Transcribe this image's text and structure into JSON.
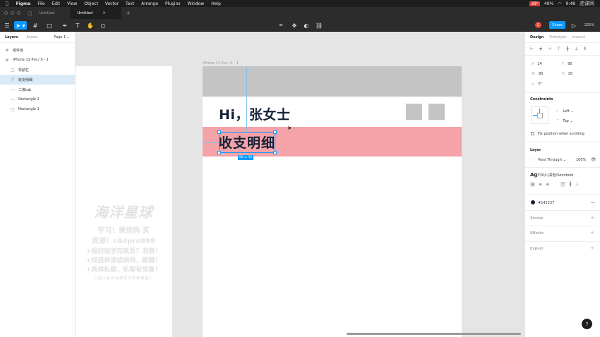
{
  "menubar": {
    "app": "Figma",
    "items": [
      "File",
      "Edit",
      "View",
      "Object",
      "Vector",
      "Text",
      "Arrange",
      "Plugins",
      "Window",
      "Help"
    ],
    "battery": "39°",
    "percent": "49%",
    "time": "9:48",
    "watermark": "虎课网"
  },
  "tabs": [
    {
      "label": "Untitled"
    },
    {
      "label": "Untitled"
    }
  ],
  "toolbar": {
    "share_label": "Share",
    "avatar_letter": "G",
    "zoom": "221%"
  },
  "left_panel": {
    "tab_layers": "Layers",
    "tab_assets": "Assets",
    "page": "Page 1",
    "layers": [
      {
        "label": "组件库",
        "icon": "#"
      },
      {
        "label": "iPhone 11 Pro / X - 1",
        "icon": "#"
      },
      {
        "label": "导航栏",
        "icon": "□"
      },
      {
        "label": "收支明细",
        "icon": "T"
      },
      {
        "label": "二级tab",
        "icon": "—"
      },
      {
        "label": "Rectangle 2",
        "icon": "—"
      },
      {
        "label": "Rectangle 1",
        "icon": "□"
      }
    ]
  },
  "canvas": {
    "frame_label": "iPhone 11 Pro / X - 1",
    "greeting": "Hi，张女士",
    "section_title": "收支明细",
    "size_badge": "80 × 30",
    "watermark": {
      "title": "海洋星球",
      "line1": "学习！微信购 买",
      "line2": "资源！c4dpro998",
      "line3": "+报的班学完就丢？浪费！",
      "line4": "+找我换课或换钱，稳赚！",
      "line5": "+具体私聊，私聊有惊喜！",
      "line6": "+加入会员免费学习所有课程+"
    }
  },
  "right_panel": {
    "tab_design": "Design",
    "tab_prototype": "Prototype",
    "tab_inspect": "Inspect",
    "x_label": "X",
    "x": "24",
    "y_label": "Y",
    "y": "95",
    "w_label": "W",
    "w": "80",
    "h_label": "H",
    "h": "30",
    "rotation": "0°",
    "constraints_title": "Constraints",
    "constraint_h": "Left",
    "constraint_v": "Top",
    "fix_position": "Fix position when scrolling",
    "layer_title": "Layer",
    "blend_mode": "Pass Through",
    "opacity": "100%",
    "font_icon": "Ag",
    "font_style": "F20/L/深色/Semibold",
    "fill_hex": "#142237",
    "stroke_title": "Stroke",
    "effects_title": "Effects",
    "export_title": "Export",
    "help": "?"
  },
  "colors": {
    "accent": "#0d99ff",
    "header_gray": "#c4c4c4",
    "pink_band": "#f5a3a8",
    "text_dark": "#142237"
  }
}
